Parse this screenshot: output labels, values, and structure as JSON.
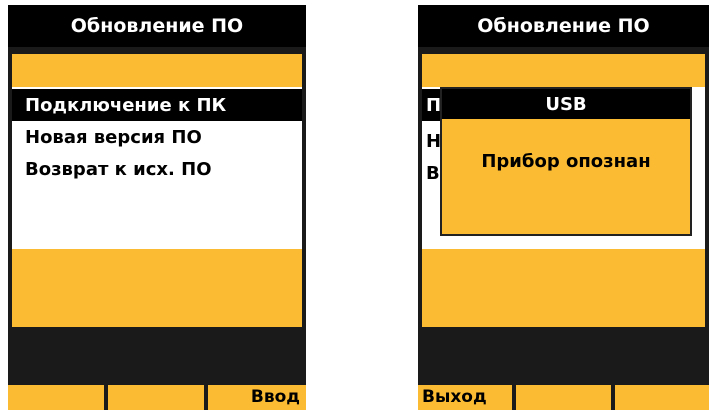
{
  "left": {
    "title": "Обновление ПО",
    "menu": [
      {
        "label": "Подключение к ПК",
        "selected": true
      },
      {
        "label": "Новая версия ПО",
        "selected": false
      },
      {
        "label": "Возврат к исх. ПО",
        "selected": false
      }
    ],
    "softkeys": [
      "",
      "",
      "Ввод"
    ]
  },
  "right": {
    "title": "Обновление ПО",
    "peek_letters": [
      "П",
      "Н",
      "В"
    ],
    "dialog": {
      "title": "USB",
      "message": "Прибор опознан"
    },
    "softkeys": [
      "Выход",
      "",
      ""
    ]
  },
  "colors": {
    "accent": "#fbbc33",
    "dark": "#1a1a1a",
    "title_bg": "#000000"
  }
}
